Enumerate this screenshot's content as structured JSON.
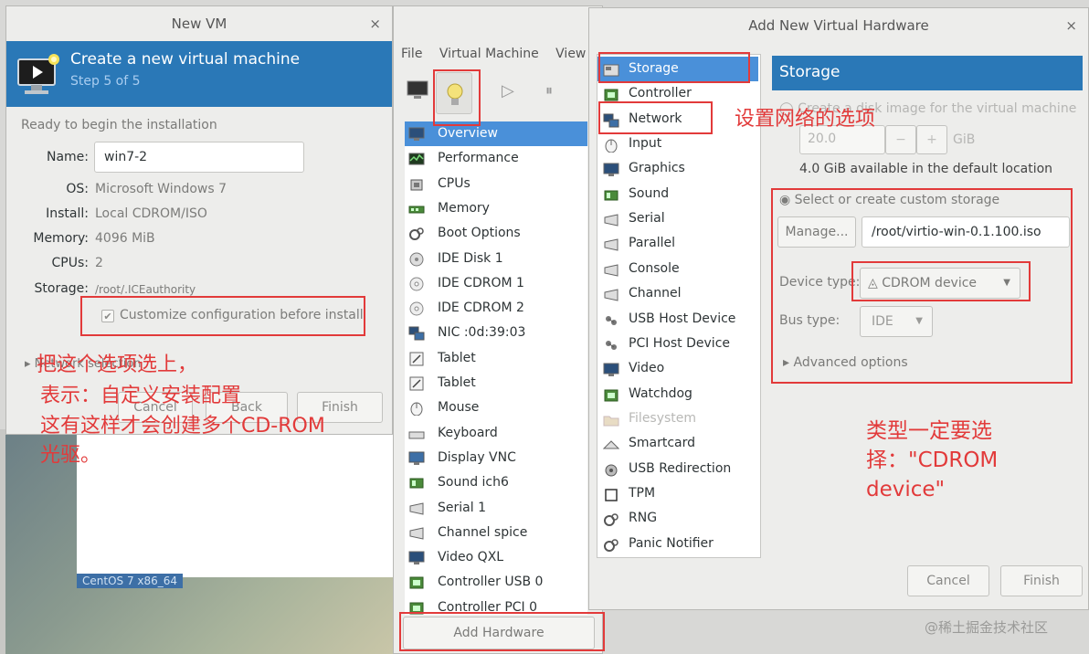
{
  "new_vm": {
    "title": "New VM",
    "close": "×",
    "header_title": "Create a new virtual machine",
    "header_step": "Step 5 of 5",
    "ready_text": "Ready to begin the installation",
    "name_label": "Name:",
    "name_value": "win7-2",
    "os_label": "OS:",
    "os_value": "Microsoft Windows 7",
    "install_label": "Install:",
    "install_value": "Local CDROM/ISO",
    "memory_label": "Memory:",
    "memory_value": "4096 MiB",
    "cpus_label": "CPUs:",
    "cpus_value": "2",
    "storage_label": "Storage:",
    "storage_value": "/root/.ICEauthority",
    "customize_label": "Customize configuration before install",
    "network_label": "Network selection",
    "cancel": "Cancel",
    "back": "Back",
    "finish": "Finish"
  },
  "desktop_label": "CentOS 7 x86_64",
  "vm_details": {
    "menu": [
      "File",
      "Virtual Machine",
      "View"
    ],
    "nav": [
      {
        "label": "Overview",
        "icon": "monitor-icon",
        "selected": true
      },
      {
        "label": "Performance",
        "icon": "performance-icon"
      },
      {
        "label": "CPUs",
        "icon": "cpu-icon"
      },
      {
        "label": "Memory",
        "icon": "memory-icon"
      },
      {
        "label": "Boot Options",
        "icon": "gears-icon"
      },
      {
        "label": "IDE Disk 1",
        "icon": "disk-icon"
      },
      {
        "label": "IDE CDROM 1",
        "icon": "cdrom-icon"
      },
      {
        "label": "IDE CDROM 2",
        "icon": "cdrom-icon"
      },
      {
        "label": "NIC :0d:39:03",
        "icon": "network-icon"
      },
      {
        "label": "Tablet",
        "icon": "tablet-icon"
      },
      {
        "label": "Tablet",
        "icon": "tablet-icon"
      },
      {
        "label": "Mouse",
        "icon": "mouse-icon"
      },
      {
        "label": "Keyboard",
        "icon": "keyboard-icon"
      },
      {
        "label": "Display VNC",
        "icon": "display-icon"
      },
      {
        "label": "Sound ich6",
        "icon": "sound-icon"
      },
      {
        "label": "Serial 1",
        "icon": "serial-icon"
      },
      {
        "label": "Channel spice",
        "icon": "serial-icon"
      },
      {
        "label": "Video QXL",
        "icon": "monitor-icon"
      },
      {
        "label": "Controller USB 0",
        "icon": "controller-icon"
      },
      {
        "label": "Controller PCI 0",
        "icon": "controller-icon"
      }
    ],
    "add_hardware": "Add Hardware"
  },
  "add_hw": {
    "title": "Add New Virtual Hardware",
    "close": "×",
    "items": [
      {
        "label": "Storage",
        "icon": "storage-icon",
        "selected": true
      },
      {
        "label": "Controller",
        "icon": "controller-icon"
      },
      {
        "label": "Network",
        "icon": "network-icon"
      },
      {
        "label": "Input",
        "icon": "mouse-icon"
      },
      {
        "label": "Graphics",
        "icon": "monitor-icon"
      },
      {
        "label": "Sound",
        "icon": "sound-icon"
      },
      {
        "label": "Serial",
        "icon": "serial-icon"
      },
      {
        "label": "Parallel",
        "icon": "serial-icon"
      },
      {
        "label": "Console",
        "icon": "serial-icon"
      },
      {
        "label": "Channel",
        "icon": "serial-icon"
      },
      {
        "label": "USB Host Device",
        "icon": "usb-icon"
      },
      {
        "label": "PCI Host Device",
        "icon": "usb-icon"
      },
      {
        "label": "Video",
        "icon": "monitor-icon"
      },
      {
        "label": "Watchdog",
        "icon": "controller-icon"
      },
      {
        "label": "Filesystem",
        "icon": "folder-icon",
        "disabled": true
      },
      {
        "label": "Smartcard",
        "icon": "smartcard-icon"
      },
      {
        "label": "USB Redirection",
        "icon": "usb-redirect-icon"
      },
      {
        "label": "TPM",
        "icon": "tpm-icon"
      },
      {
        "label": "RNG",
        "icon": "gears-icon"
      },
      {
        "label": "Panic Notifier",
        "icon": "gears-icon"
      }
    ],
    "storage_title": "Storage",
    "create_disk_label": "Create a disk image for the virtual machine",
    "disk_size": "20.0",
    "minus": "−",
    "plus": "+",
    "unit": "GiB",
    "available": "4.0 GiB available in the default location",
    "custom_label": "Select or create custom storage",
    "manage": "Manage...",
    "path": "/root/virtio-win-0.1.100.iso",
    "device_type_label": "Device type:",
    "device_type_value": "CDROM device",
    "bus_type_label": "Bus type:",
    "bus_type_value": "IDE",
    "advanced": "Advanced options",
    "cancel": "Cancel",
    "finish": "Finish"
  },
  "annotations": {
    "network_note": "设置网络的选项",
    "customize_note_1": "把这个选项选上，",
    "customize_note_2": "表示：自定义安装配置",
    "customize_note_3": "这有这样才会创建多个CD-ROM",
    "customize_note_4": "光驱。",
    "cdrom_note_1": "类型一定要选",
    "cdrom_note_2": "择：\"CDROM",
    "cdrom_note_3": "device\""
  },
  "watermark": "@稀土掘金技术社区",
  "colors": {
    "header_blue": "#2a78b7",
    "selection_blue": "#4a90d9",
    "annotation_red": "#e23a3a",
    "window_bg": "#ededeb"
  }
}
